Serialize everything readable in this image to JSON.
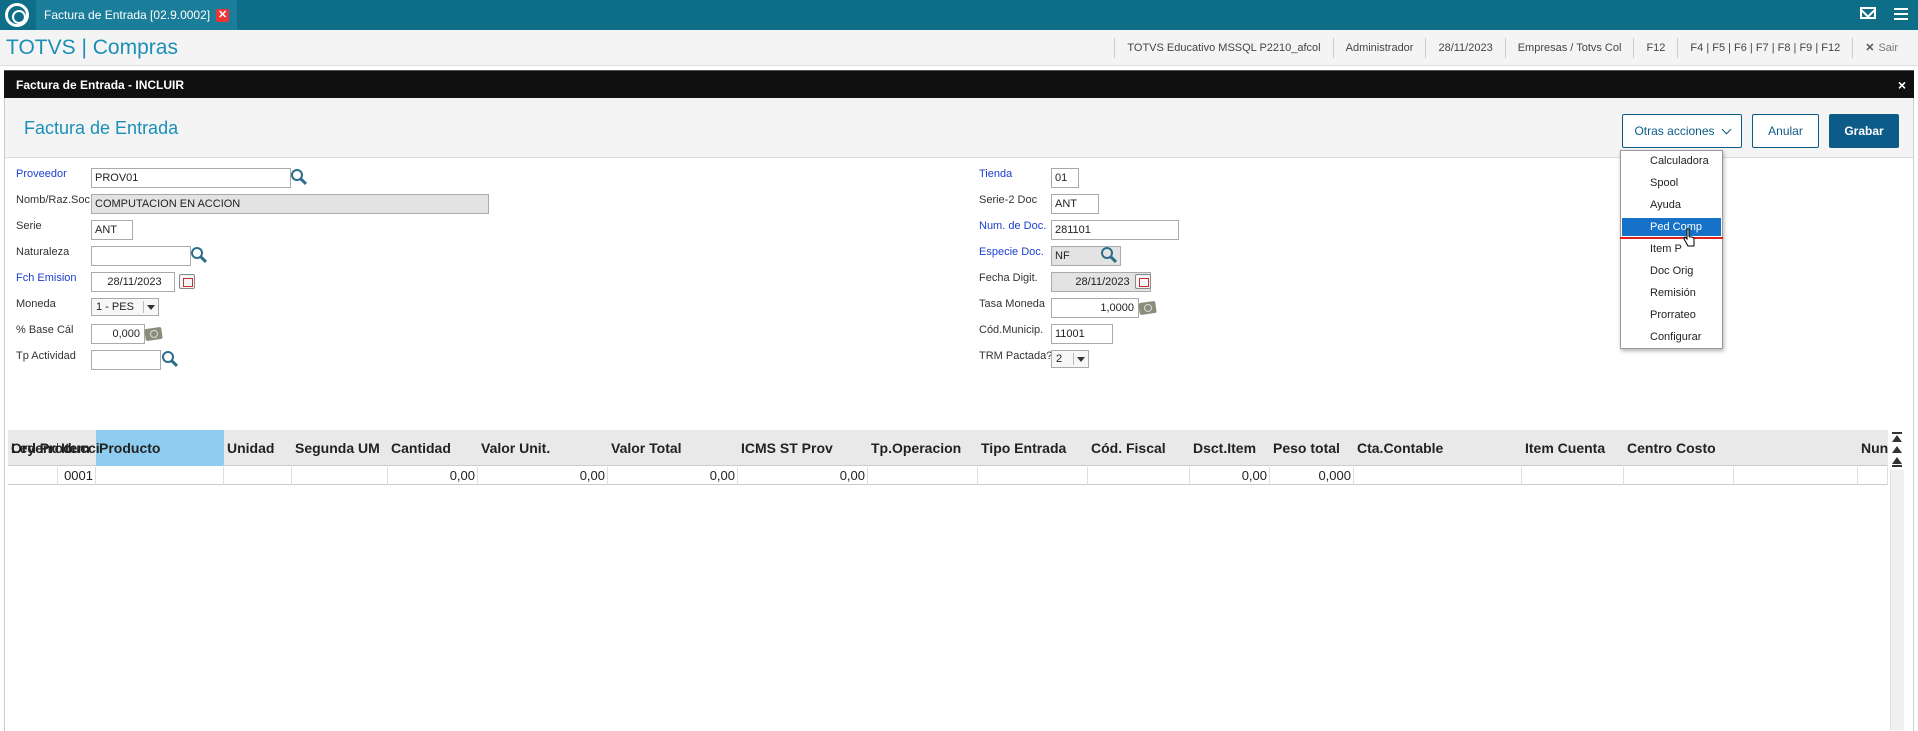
{
  "topbar": {
    "tab_label": "Factura de Entrada [02.9.0002]",
    "tab_close": "✕"
  },
  "header": {
    "app_title": "TOTVS | Compras",
    "environment": "TOTVS Educativo MSSQL P2210_afcol",
    "user": "Administrador",
    "date": "28/11/2023",
    "company": "Empresas / Totvs Col",
    "help_key": "F12",
    "shortcuts": "F4 | F5 | F6 | F7 | F8 | F9 | F12",
    "exit_label": "Sair"
  },
  "dialog": {
    "title": "Factura de Entrada - INCLUIR",
    "close": "×"
  },
  "form": {
    "title": "Factura de Entrada",
    "buttons": {
      "otras": "Otras acciones",
      "anular": "Anular",
      "grabar": "Grabar"
    },
    "left": {
      "proveedor_label": "Proveedor",
      "proveedor_value": "PROV01",
      "nomb_label": "Nomb/Raz.Soc",
      "nomb_value": "COMPUTACION EN ACCION",
      "serie_label": "Serie",
      "serie_value": "ANT",
      "naturaleza_label": "Naturaleza",
      "naturaleza_value": "",
      "fch_label": "Fch Emision",
      "fch_value": "28/11/2023",
      "moneda_label": "Moneda",
      "moneda_value": "1 - PES",
      "base_label": "% Base Cál",
      "base_value": "0,000",
      "tp_label": "Tp Actividad",
      "tp_value": ""
    },
    "right": {
      "tienda_label": "Tienda",
      "tienda_value": "01",
      "serie2_label": "Serie-2 Doc",
      "serie2_value": "ANT",
      "numdoc_label": "Num. de Doc.",
      "numdoc_value": "281101",
      "especie_label": "Especie Doc.",
      "especie_value": "NF",
      "fdigit_label": "Fecha Digit.",
      "fdigit_value": "28/11/2023",
      "tasa_label": "Tasa Moneda",
      "tasa_value": "1,0000",
      "codmun_label": "Cód.Municip.",
      "codmun_value": "11001",
      "trm_label": "TRM Pactada?",
      "trm_value": "2"
    }
  },
  "dropdown": {
    "items": [
      "Calculadora",
      "Spool",
      "Ayuda",
      "Ped Comp",
      "Item P",
      "Doc Orig",
      "Remisión",
      "Prorrateo",
      "Configurar"
    ],
    "selected_index": 3
  },
  "grid": {
    "columns": [
      "Leyend",
      "Item",
      "Producto",
      "Unidad",
      "Segunda UM",
      "Cantidad",
      "Valor Unit.",
      "Valor Total",
      "ICMS ST Prov",
      "Tp.Operacion",
      "Tipo Entrada",
      "Cód. Fiscal",
      "Dsct.Item",
      "Peso total",
      "Cta.Contable",
      "Item Cuenta",
      "Centro Costo",
      "Ord Producci",
      "Nun"
    ],
    "row": [
      "",
      "0001",
      "",
      "",
      "",
      "0,00",
      "0,00",
      "0,00",
      "0,00",
      "",
      "",
      "",
      "0,00",
      "0,000",
      "",
      "",
      "",
      "",
      ""
    ]
  }
}
